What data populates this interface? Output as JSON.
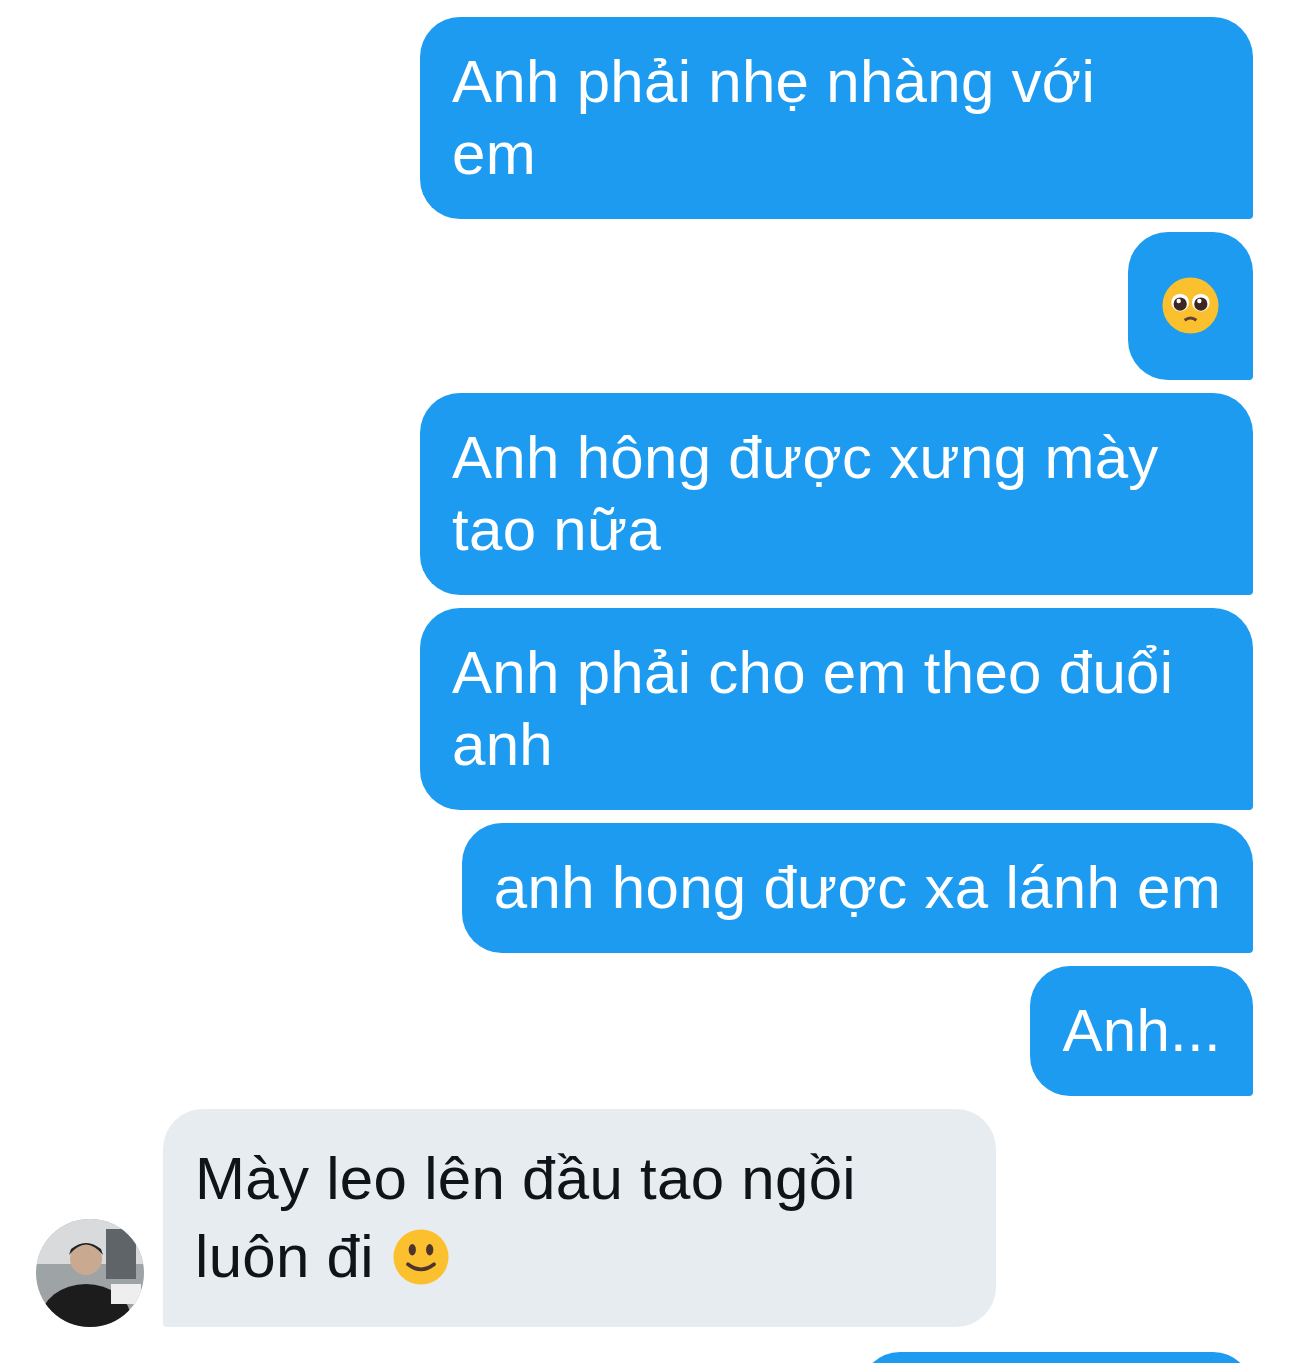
{
  "messages": [
    {
      "kind": "outgoing",
      "lines": [
        "Anh phải nhẹ nhàng với",
        "em"
      ]
    },
    {
      "kind": "outgoing_pleading_face"
    },
    {
      "kind": "outgoing",
      "lines": [
        "Anh hông được xưng mày",
        "tao nữa"
      ]
    },
    {
      "kind": "outgoing",
      "lines": [
        "Anh phải cho em theo đuổi",
        "anh"
      ]
    },
    {
      "kind": "outgoing",
      "lines": [
        "anh hong được xa lánh em"
      ]
    },
    {
      "kind": "outgoing",
      "lines": [
        "Anh..."
      ]
    },
    {
      "kind": "incoming_with_smile",
      "lines": [
        "Mày leo lên đầu tao ngồi",
        "luôn đi"
      ]
    },
    {
      "kind": "outgoing_cut"
    }
  ]
}
